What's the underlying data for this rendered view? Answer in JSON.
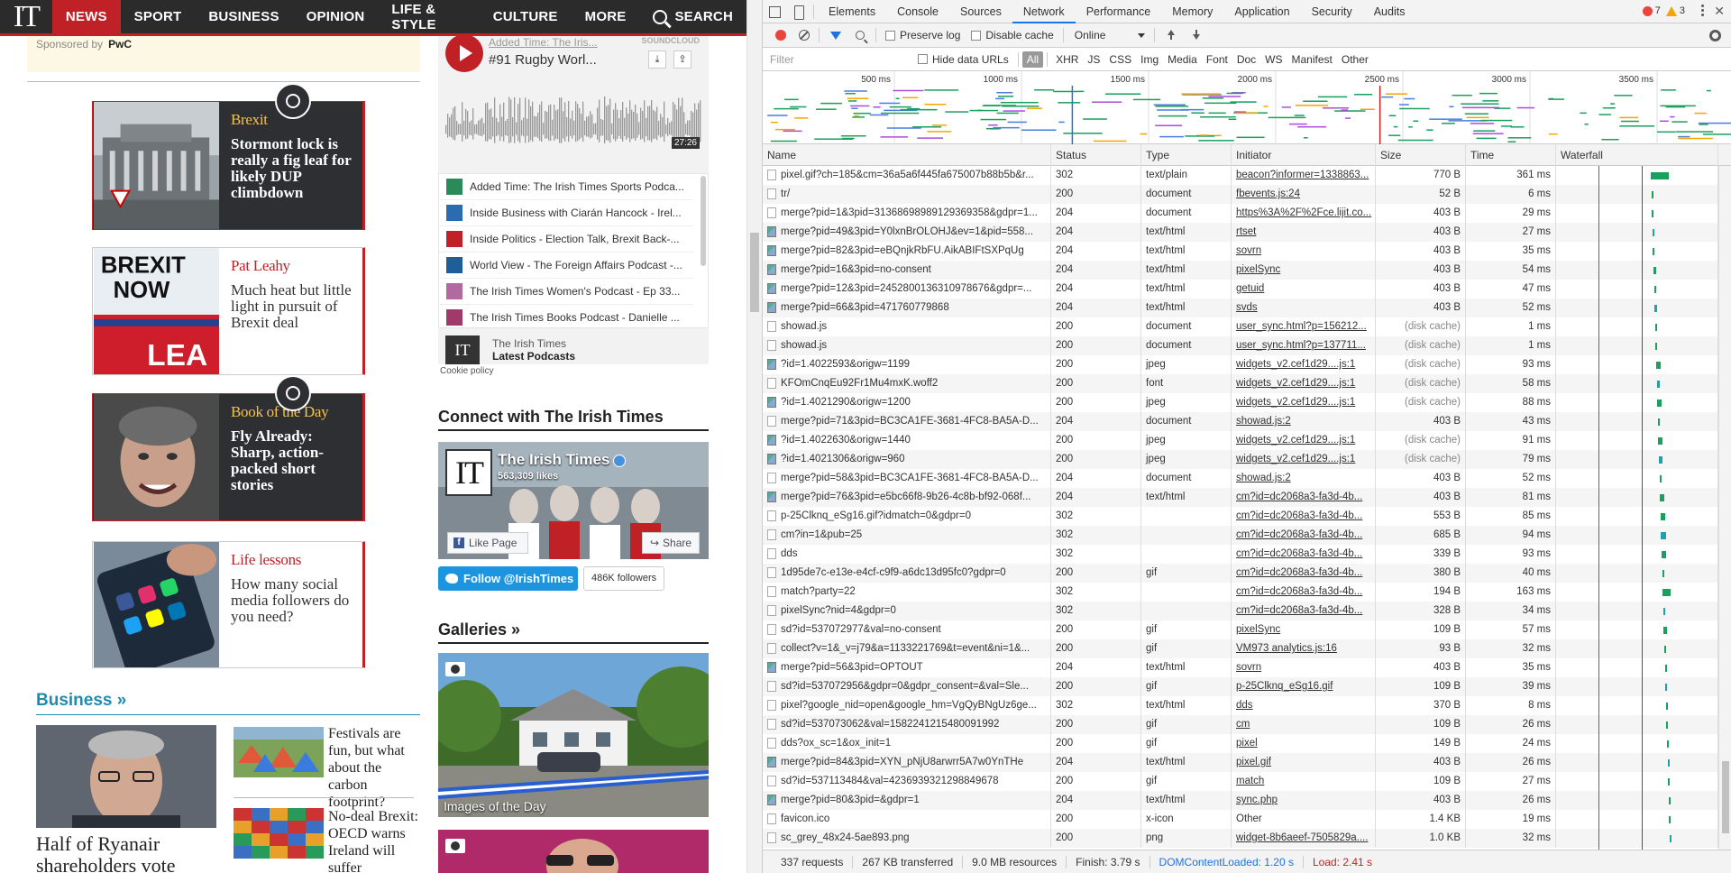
{
  "site": {
    "logo": "IT",
    "nav": [
      {
        "label": "NEWS",
        "active": true
      },
      {
        "label": "SPORT",
        "active": false
      },
      {
        "label": "BUSINESS",
        "active": false
      },
      {
        "label": "OPINION",
        "active": false
      },
      {
        "label": "LIFE & STYLE",
        "active": false
      },
      {
        "label": "CULTURE",
        "active": false
      },
      {
        "label": "MORE",
        "active": false
      }
    ],
    "search_label": "SEARCH",
    "sponsor_label": "Sponsored by",
    "sponsor_name": "PwC",
    "cards": [
      {
        "kicker": "Brexit",
        "headline": "Stormont lock is really a fig leaf for likely DUP climbdown",
        "style": "dark"
      },
      {
        "kicker": "Pat Leahy",
        "headline": "Much heat but little light in pursuit of Brexit deal",
        "style": "light"
      },
      {
        "kicker": "Book of the Day",
        "headline": "Fly Already: Sharp, action-packed short stories",
        "style": "dark"
      },
      {
        "kicker": "Life lessons",
        "headline": "How many social media followers do you need?",
        "style": "light"
      }
    ],
    "business_heading": "Business »",
    "business_lead": "Half of Ryanair shareholders vote",
    "business_items": [
      "Festivals are fun, but what about the carbon footprint?",
      "No-deal Brexit: OECD warns Ireland will suffer"
    ],
    "soundcloud": {
      "subtitle": "Added Time: The Iris...",
      "brand": "SOUNDCLOUD",
      "title": "#91 Rugby Worl...",
      "duration": "27:26",
      "playlist": [
        "Added Time: The Irish Times Sports Podca...",
        "Inside Business with Ciarán Hancock - Irel...",
        "Inside Politics - Election Talk, Brexit Back-...",
        "World View - The Foreign Affairs Podcast -...",
        "The Irish Times Women's Podcast - Ep 33...",
        "The Irish Times Books Podcast - Danielle ..."
      ],
      "footer_line1": "The Irish Times",
      "footer_line2": "Latest Podcasts",
      "cookie": "Cookie policy"
    },
    "connect_heading": "Connect with The Irish Times",
    "facebook": {
      "name": "The Irish Times",
      "likes": "563,309 likes",
      "like_label": "Like Page",
      "share_label": "Share"
    },
    "twitter": {
      "follow_label": "Follow @IrishTimes",
      "followers": "486K followers"
    },
    "galleries_heading": "Galleries »",
    "gallery_caption": "Images of the Day"
  },
  "devtools": {
    "tabs": [
      "Elements",
      "Console",
      "Sources",
      "Network",
      "Performance",
      "Memory",
      "Application",
      "Security",
      "Audits"
    ],
    "active_tab": "Network",
    "errors": "7",
    "warnings": "3",
    "toolbar": {
      "preserve_log": "Preserve log",
      "disable_cache": "Disable cache",
      "throttle": "Online"
    },
    "filter": {
      "placeholder": "Filter",
      "hide_data_urls": "Hide data URLs",
      "types": [
        "All",
        "XHR",
        "JS",
        "CSS",
        "Img",
        "Media",
        "Font",
        "Doc",
        "WS",
        "Manifest",
        "Other"
      ]
    },
    "overview_ticks": [
      "500 ms",
      "1000 ms",
      "1500 ms",
      "2000 ms",
      "2500 ms",
      "3000 ms",
      "3500 ms"
    ],
    "columns": [
      "Name",
      "Status",
      "Type",
      "Initiator",
      "Size",
      "Time",
      "Waterfall"
    ],
    "rows": [
      {
        "name": "pixel.gif?ch=185&cm=36a5a6f445fa675007b88b5b&r...",
        "status": "302",
        "type": "text/plain",
        "initiator": "beacon?informer=1338863...",
        "size": "770 B",
        "time": "361 ms",
        "icon": "doc"
      },
      {
        "name": "tr/",
        "status": "200",
        "type": "document",
        "initiator": "fbevents.js:24",
        "size": "52 B",
        "time": "6 ms",
        "icon": "doc"
      },
      {
        "name": "merge?pid=1&3pid=31368698989129369358&gdpr=1...",
        "status": "204",
        "type": "document",
        "initiator": "https%3A%2F%2Fce.lijit.co...",
        "size": "403 B",
        "time": "29 ms",
        "icon": "doc"
      },
      {
        "name": "merge?pid=49&3pid=Y0lxnBrOLOHJ&ev=1&pid=558...",
        "status": "204",
        "type": "text/html",
        "initiator": "rtset",
        "size": "403 B",
        "time": "27 ms",
        "icon": "img"
      },
      {
        "name": "merge?pid=82&3pid=eBQnjkRbFU.AikABIFtSXPqUg",
        "status": "204",
        "type": "text/html",
        "initiator": "sovrn",
        "size": "403 B",
        "time": "35 ms",
        "icon": "img"
      },
      {
        "name": "merge?pid=16&3pid=no-consent",
        "status": "204",
        "type": "text/html",
        "initiator": "pixelSync",
        "size": "403 B",
        "time": "54 ms",
        "icon": "img"
      },
      {
        "name": "merge?pid=12&3pid=2452800136310978676&gdpr=...",
        "status": "204",
        "type": "text/html",
        "initiator": "getuid",
        "size": "403 B",
        "time": "47 ms",
        "icon": "img"
      },
      {
        "name": "merge?pid=66&3pid=471760779868",
        "status": "204",
        "type": "text/html",
        "initiator": "svds",
        "size": "403 B",
        "time": "52 ms",
        "icon": "img"
      },
      {
        "name": "showad.js",
        "status": "200",
        "type": "document",
        "initiator": "user_sync.html?p=156212...",
        "size": "(disk cache)",
        "time": "1 ms",
        "icon": "doc"
      },
      {
        "name": "showad.js",
        "status": "200",
        "type": "document",
        "initiator": "user_sync.html?p=137711...",
        "size": "(disk cache)",
        "time": "1 ms",
        "icon": "doc"
      },
      {
        "name": "?id=1.4022593&origw=1199",
        "status": "200",
        "type": "jpeg",
        "initiator": "widgets_v2.cef1d29....js:1",
        "size": "(disk cache)",
        "time": "93 ms",
        "icon": "img"
      },
      {
        "name": "KFOmCnqEu92Fr1Mu4mxK.woff2",
        "status": "200",
        "type": "font",
        "initiator": "widgets_v2.cef1d29....js:1",
        "size": "(disk cache)",
        "time": "58 ms",
        "icon": "doc"
      },
      {
        "name": "?id=1.4021290&origw=1200",
        "status": "200",
        "type": "jpeg",
        "initiator": "widgets_v2.cef1d29....js:1",
        "size": "(disk cache)",
        "time": "88 ms",
        "icon": "img"
      },
      {
        "name": "merge?pid=71&3pid=BC3CA1FE-3681-4FC8-BA5A-D...",
        "status": "204",
        "type": "document",
        "initiator": "showad.js:2",
        "size": "403 B",
        "time": "43 ms",
        "icon": "doc"
      },
      {
        "name": "?id=1.4022630&origw=1440",
        "status": "200",
        "type": "jpeg",
        "initiator": "widgets_v2.cef1d29....js:1",
        "size": "(disk cache)",
        "time": "91 ms",
        "icon": "img"
      },
      {
        "name": "?id=1.4021306&origw=960",
        "status": "200",
        "type": "jpeg",
        "initiator": "widgets_v2.cef1d29....js:1",
        "size": "(disk cache)",
        "time": "79 ms",
        "icon": "img"
      },
      {
        "name": "merge?pid=58&3pid=BC3CA1FE-3681-4FC8-BA5A-D...",
        "status": "204",
        "type": "document",
        "initiator": "showad.js:2",
        "size": "403 B",
        "time": "52 ms",
        "icon": "doc"
      },
      {
        "name": "merge?pid=76&3pid=e5bc66f8-9b26-4c8b-bf92-068f...",
        "status": "204",
        "type": "text/html",
        "initiator": "cm?id=dc2068a3-fa3d-4b...",
        "size": "403 B",
        "time": "81 ms",
        "icon": "img"
      },
      {
        "name": "p-25Clknq_eSg16.gif?idmatch=0&gdpr=0",
        "status": "302",
        "type": "",
        "initiator": "cm?id=dc2068a3-fa3d-4b...",
        "size": "553 B",
        "time": "85 ms",
        "icon": "doc"
      },
      {
        "name": "cm?in=1&pub=25",
        "status": "302",
        "type": "",
        "initiator": "cm?id=dc2068a3-fa3d-4b...",
        "size": "685 B",
        "time": "94 ms",
        "icon": "doc"
      },
      {
        "name": "dds",
        "status": "302",
        "type": "",
        "initiator": "cm?id=dc2068a3-fa3d-4b...",
        "size": "339 B",
        "time": "93 ms",
        "icon": "doc"
      },
      {
        "name": "1d95de7c-e13e-e4cf-c9f9-a6dc13d95fc0?gdpr=0",
        "status": "200",
        "type": "gif",
        "initiator": "cm?id=dc2068a3-fa3d-4b...",
        "size": "380 B",
        "time": "40 ms",
        "icon": "doc"
      },
      {
        "name": "match?party=22",
        "status": "302",
        "type": "",
        "initiator": "cm?id=dc2068a3-fa3d-4b...",
        "size": "194 B",
        "time": "163 ms",
        "icon": "doc"
      },
      {
        "name": "pixelSync?nid=4&gdpr=0",
        "status": "302",
        "type": "",
        "initiator": "cm?id=dc2068a3-fa3d-4b...",
        "size": "328 B",
        "time": "34 ms",
        "icon": "doc"
      },
      {
        "name": "sd?id=537072977&val=no-consent",
        "status": "200",
        "type": "gif",
        "initiator": "pixelSync",
        "size": "109 B",
        "time": "57 ms",
        "icon": "doc"
      },
      {
        "name": "collect?v=1&_v=j79&a=1133221769&t=event&ni=1&...",
        "status": "200",
        "type": "gif",
        "initiator": "VM973 analytics.js:16",
        "size": "93 B",
        "time": "32 ms",
        "icon": "doc"
      },
      {
        "name": "merge?pid=56&3pid=OPTOUT",
        "status": "204",
        "type": "text/html",
        "initiator": "sovrn",
        "size": "403 B",
        "time": "35 ms",
        "icon": "img"
      },
      {
        "name": "sd?id=537072956&gdpr=0&gdpr_consent=&val=Sle...",
        "status": "200",
        "type": "gif",
        "initiator": "p-25Clknq_eSg16.gif",
        "size": "109 B",
        "time": "39 ms",
        "icon": "doc"
      },
      {
        "name": "pixel?google_nid=open&google_hm=VgQyBNgUz6ge...",
        "status": "302",
        "type": "text/html",
        "initiator": "dds",
        "size": "370 B",
        "time": "8 ms",
        "icon": "doc"
      },
      {
        "name": "sd?id=537073062&val=1582241215480091992",
        "status": "200",
        "type": "gif",
        "initiator": "cm",
        "size": "109 B",
        "time": "26 ms",
        "icon": "doc"
      },
      {
        "name": "dds?ox_sc=1&ox_init=1",
        "status": "200",
        "type": "gif",
        "initiator": "pixel",
        "size": "149 B",
        "time": "24 ms",
        "icon": "doc"
      },
      {
        "name": "merge?pid=84&3pid=XYN_pNjU8arwrr5A7w0YnTHe",
        "status": "204",
        "type": "text/html",
        "initiator": "pixel.gif",
        "size": "403 B",
        "time": "26 ms",
        "icon": "img"
      },
      {
        "name": "sd?id=537113484&val=4236939321298849678",
        "status": "200",
        "type": "gif",
        "initiator": "match",
        "size": "109 B",
        "time": "27 ms",
        "icon": "doc"
      },
      {
        "name": "merge?pid=80&3pid=&gdpr=1",
        "status": "204",
        "type": "text/html",
        "initiator": "sync.php",
        "size": "403 B",
        "time": "26 ms",
        "icon": "img"
      },
      {
        "name": "favicon.ico",
        "status": "200",
        "type": "x-icon",
        "initiator": "Other",
        "size": "1.4 KB",
        "time": "19 ms",
        "icon": "doc"
      },
      {
        "name": "sc_grey_48x24-5ae893.png",
        "status": "200",
        "type": "png",
        "initiator": "widget-8b6aeef-7505829a....",
        "size": "1.0 KB",
        "time": "32 ms",
        "icon": "doc"
      }
    ],
    "status_bar": [
      "337 requests",
      "267 KB transferred",
      "9.0 MB resources",
      "Finish: 3.79 s",
      "DOMContentLoaded: 1.20 s",
      "Load: 2.41 s"
    ]
  },
  "colors": {
    "brand_red": "#c02126",
    "business_blue": "#1e8bb3",
    "devtools_blue": "#1a73e8",
    "kicker_gold": "#f7c24c"
  }
}
